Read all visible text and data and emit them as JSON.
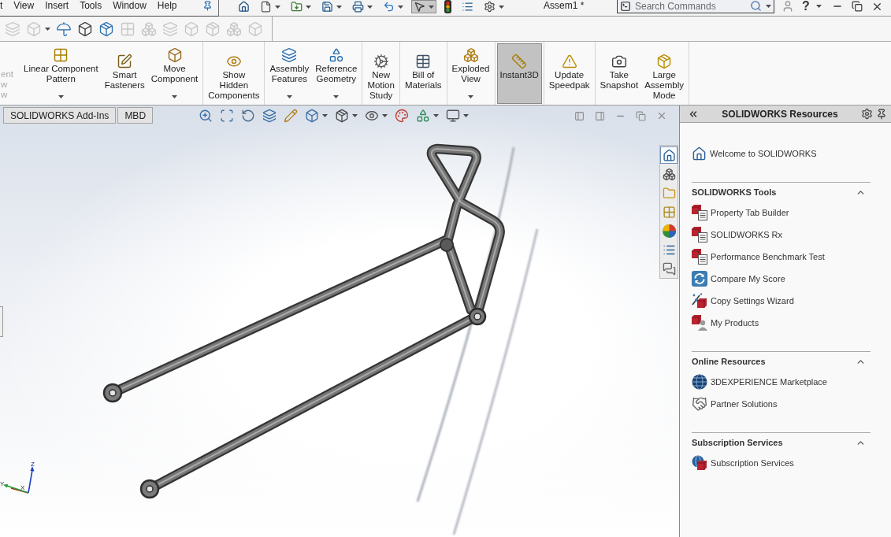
{
  "menu_bar": {
    "items": [
      "t",
      "View",
      "Insert",
      "Tools",
      "Window",
      "Help"
    ]
  },
  "quick_access": [
    {
      "dropdown": false,
      "selected": false
    },
    {
      "dropdown": true,
      "selected": false
    },
    {
      "dropdown": true,
      "selected": false
    },
    {
      "dropdown": true,
      "selected": false
    },
    {
      "dropdown": true,
      "selected": false
    },
    {
      "dropdown": true,
      "selected": false
    },
    {
      "dropdown": true,
      "selected": true
    },
    {
      "dropdown": false,
      "selected": false
    },
    {
      "dropdown": false,
      "selected": false
    },
    {
      "dropdown": true,
      "selected": false
    }
  ],
  "document_title": "Assem1 *",
  "search": {
    "placeholder": "Search Commands"
  },
  "help": {
    "glyph": "?"
  },
  "toolbar": [
    {
      "disabled": true,
      "dropdown": false
    },
    {
      "disabled": true,
      "dropdown": true
    },
    {
      "disabled": false,
      "dropdown": false
    },
    {
      "disabled": false,
      "dropdown": false
    },
    {
      "disabled": false,
      "dropdown": false
    },
    {
      "disabled": true,
      "dropdown": false
    },
    {
      "disabled": true,
      "dropdown": false
    },
    {
      "disabled": true,
      "dropdown": false
    },
    {
      "disabled": true,
      "dropdown": false
    },
    {
      "disabled": true,
      "dropdown": false
    },
    {
      "disabled": true,
      "dropdown": false
    },
    {
      "disabled": true,
      "dropdown": false
    }
  ],
  "ribbon": {
    "groups": [
      {
        "buttons": [
          {
            "label": "ent\nw\nw",
            "dropdown": false,
            "selected": false,
            "disabled": true
          }
        ]
      },
      {
        "buttons": [
          {
            "label": "Linear Component\nPattern",
            "dropdown": true,
            "selected": false,
            "disabled": false
          },
          {
            "label": "Smart\nFasteners",
            "dropdown": false,
            "selected": false,
            "disabled": false
          },
          {
            "label": "Move\nComponent",
            "dropdown": true,
            "selected": false,
            "disabled": false
          }
        ]
      },
      {
        "buttons": [
          {
            "label": "Show\nHidden\nComponents",
            "dropdown": false,
            "selected": false,
            "disabled": false
          }
        ]
      },
      {
        "buttons": [
          {
            "label": "Assembly\nFeatures",
            "dropdown": true,
            "selected": false,
            "disabled": false
          },
          {
            "label": "Reference\nGeometry",
            "dropdown": true,
            "selected": false,
            "disabled": false
          }
        ]
      },
      {
        "buttons": [
          {
            "label": "New\nMotion\nStudy",
            "dropdown": false,
            "selected": false,
            "disabled": false
          }
        ]
      },
      {
        "buttons": [
          {
            "label": "Bill of\nMaterials",
            "dropdown": false,
            "selected": false,
            "disabled": false
          }
        ]
      },
      {
        "buttons": [
          {
            "label": "Exploded\nView",
            "dropdown": true,
            "selected": false,
            "disabled": false
          }
        ]
      },
      {
        "buttons": [
          {
            "label": "Instant3D",
            "dropdown": false,
            "selected": true,
            "disabled": false
          }
        ]
      },
      {
        "buttons": [
          {
            "label": "Update\nSpeedpak",
            "dropdown": false,
            "selected": false,
            "disabled": false
          }
        ]
      },
      {
        "buttons": [
          {
            "label": "Take\nSnapshot",
            "dropdown": false,
            "selected": false,
            "disabled": false
          },
          {
            "label": "Large\nAssembly\nMode",
            "dropdown": false,
            "selected": false,
            "disabled": false
          }
        ]
      }
    ]
  },
  "tabs": [
    {
      "label": "SOLIDWORKS Add-Ins",
      "selected": false
    },
    {
      "label": "MBD",
      "selected": false
    }
  ],
  "task_pane_tabs": [
    {
      "selected": true
    },
    {
      "selected": false
    },
    {
      "selected": false
    },
    {
      "selected": false
    },
    {
      "selected": false
    },
    {
      "selected": false
    },
    {
      "selected": false
    }
  ],
  "triad": {
    "labels": [
      "Z",
      "Y",
      "X"
    ]
  },
  "resources": {
    "title": "SOLIDWORKS Resources",
    "welcome": "Welcome to SOLIDWORKS",
    "sections": [
      {
        "title": "SOLIDWORKS Tools",
        "expanded": true,
        "items": [
          {
            "label": "Property Tab Builder"
          },
          {
            "label": "SOLIDWORKS Rx"
          },
          {
            "label": "Performance Benchmark Test"
          },
          {
            "label": "Compare My Score"
          },
          {
            "label": "Copy Settings Wizard"
          },
          {
            "label": "My Products"
          }
        ]
      },
      {
        "title": "Online Resources",
        "expanded": true,
        "items": [
          {
            "label": "3DEXPERIENCE Marketplace"
          },
          {
            "label": "Partner Solutions"
          }
        ]
      },
      {
        "title": "Subscription Services",
        "expanded": true,
        "items": [
          {
            "label": "Subscription Services"
          }
        ]
      }
    ]
  }
}
